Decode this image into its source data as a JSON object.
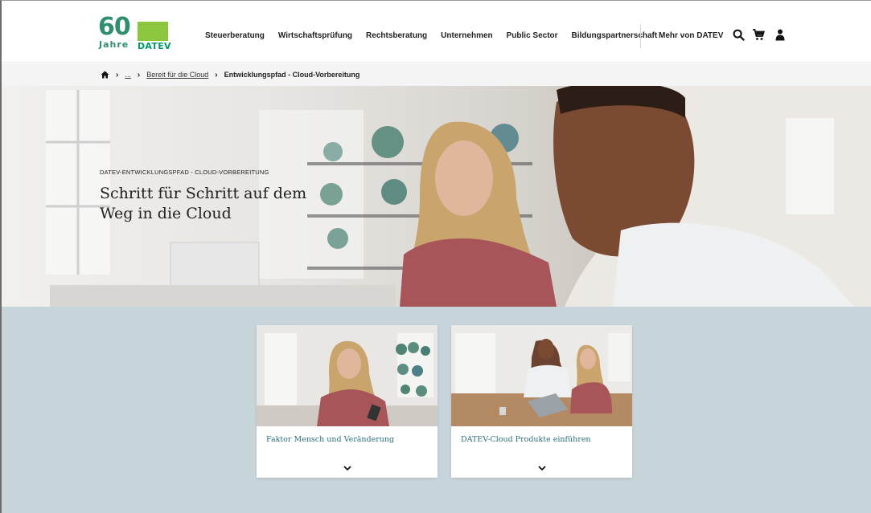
{
  "logo": {
    "years": "60",
    "jahre": "Jahre",
    "brand": "DATEV"
  },
  "nav": {
    "items": [
      "Steuerberatung",
      "Wirtschaftsprüfung",
      "Rechtsberatung",
      "Unternehmen",
      "Public Sector",
      "Bildungspartnerschaft"
    ],
    "more": "Mehr von DATEV"
  },
  "icons": {
    "search": "search-icon",
    "cart": "cart-icon",
    "account": "user-icon",
    "home": "home-icon"
  },
  "breadcrumb": {
    "ellipsis": "...",
    "parent": "Bereit für die Cloud",
    "current": "Entwicklungspfad - Cloud-Vorbereitung"
  },
  "hero": {
    "kicker": "DATEV-ENTWICKLUNGSPFAD - CLOUD-VORBEREITUNG",
    "title": "Schritt für Schritt auf dem Weg in die Cloud"
  },
  "cards": [
    {
      "label": "Faktor Mensch und Veränderung"
    },
    {
      "label": "DATEV-Cloud Produkte einführen"
    }
  ],
  "colors": {
    "brand_green": "#8cc63f",
    "teal_text": "#2a6f77",
    "section_bg": "#c7d4da"
  }
}
